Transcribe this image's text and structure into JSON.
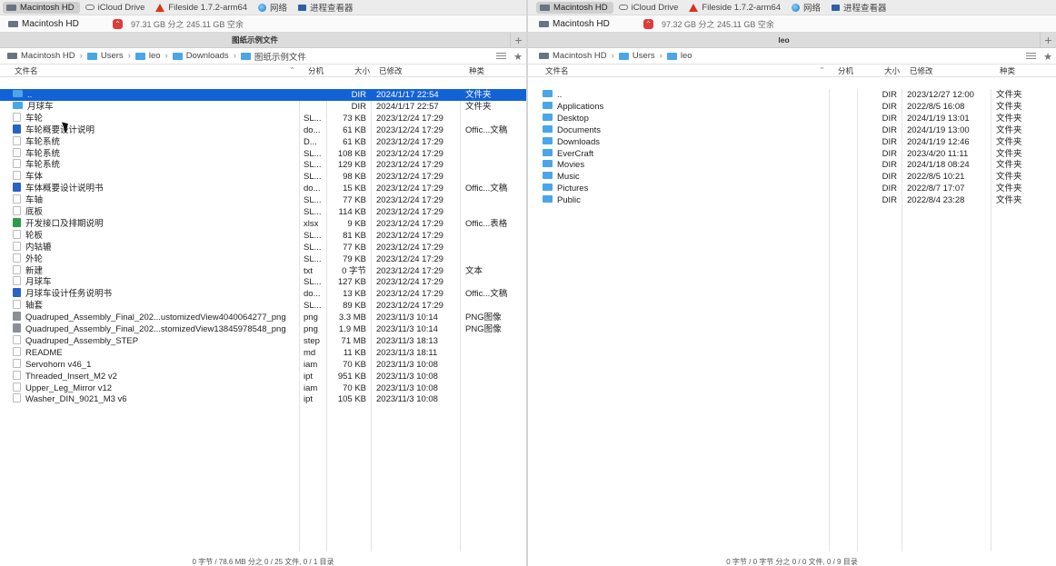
{
  "favorites": [
    {
      "label": "Macintosh HD",
      "icon": "hdd-icon",
      "active": true
    },
    {
      "label": "iCloud Drive",
      "icon": "cloud-icon"
    },
    {
      "label": "Fileside 1.7.2-arm64",
      "icon": "fileside-icon"
    },
    {
      "label": "网络",
      "icon": "globe-icon"
    },
    {
      "label": "进程查看器",
      "icon": "monitor-icon"
    }
  ],
  "headers": {
    "name": "文件名",
    "ext": "分机",
    "size": "大小",
    "modified": "已修改",
    "kind": "种类"
  },
  "left": {
    "volume": {
      "name": "Macintosh HD",
      "space": "97.31 GB 分之 245.11 GB 空余"
    },
    "title": "图纸示例文件",
    "breadcrumb": [
      "Macintosh HD",
      "Users",
      "leo",
      "Downloads",
      "图纸示例文件"
    ],
    "status": "0 字节 / 78.6 MB 分之 0 / 25 文件, 0 / 1 目录",
    "files": [
      {
        "name": "..",
        "ext": "",
        "size": "DIR",
        "modified": "2024/1/17 22:54",
        "kind": "文件夹",
        "icon": "folder"
      },
      {
        "name": "月球车",
        "ext": "",
        "size": "DIR",
        "modified": "2024/1/17 22:57",
        "kind": "文件夹",
        "icon": "folder"
      },
      {
        "name": "车轮",
        "ext": "SL...",
        "size": "73 KB",
        "modified": "2023/12/24 17:29",
        "kind": "",
        "icon": "doc"
      },
      {
        "name": "车轮概要设计说明",
        "ext": "do...",
        "size": "61 KB",
        "modified": "2023/12/24 17:29",
        "kind": "Offic...文稿",
        "icon": "word"
      },
      {
        "name": "车轮系统",
        "ext": "D...",
        "size": "61 KB",
        "modified": "2023/12/24 17:29",
        "kind": "",
        "icon": "doc"
      },
      {
        "name": "车轮系统",
        "ext": "SL...",
        "size": "108 KB",
        "modified": "2023/12/24 17:29",
        "kind": "",
        "icon": "doc"
      },
      {
        "name": "车轮系统",
        "ext": "SL...",
        "size": "129 KB",
        "modified": "2023/12/24 17:29",
        "kind": "",
        "icon": "doc"
      },
      {
        "name": "车体",
        "ext": "SL...",
        "size": "98 KB",
        "modified": "2023/12/24 17:29",
        "kind": "",
        "icon": "doc"
      },
      {
        "name": "车体概要设计说明书",
        "ext": "do...",
        "size": "15 KB",
        "modified": "2023/12/24 17:29",
        "kind": "Offic...文稿",
        "icon": "word"
      },
      {
        "name": "车轴",
        "ext": "SL...",
        "size": "77 KB",
        "modified": "2023/12/24 17:29",
        "kind": "",
        "icon": "doc"
      },
      {
        "name": "底板",
        "ext": "SL...",
        "size": "114 KB",
        "modified": "2023/12/24 17:29",
        "kind": "",
        "icon": "doc"
      },
      {
        "name": "开发接口及排期说明",
        "ext": "xlsx",
        "size": "9 KB",
        "modified": "2023/12/24 17:29",
        "kind": "Offic...表格",
        "icon": "xls"
      },
      {
        "name": "轮板",
        "ext": "SL...",
        "size": "81 KB",
        "modified": "2023/12/24 17:29",
        "kind": "",
        "icon": "doc"
      },
      {
        "name": "内轱辘",
        "ext": "SL...",
        "size": "77 KB",
        "modified": "2023/12/24 17:29",
        "kind": "",
        "icon": "doc"
      },
      {
        "name": "外轮",
        "ext": "SL...",
        "size": "79 KB",
        "modified": "2023/12/24 17:29",
        "kind": "",
        "icon": "doc"
      },
      {
        "name": "新建",
        "ext": "txt",
        "size": "0 字节",
        "modified": "2023/12/24 17:29",
        "kind": "文本",
        "icon": "doc"
      },
      {
        "name": "月球车",
        "ext": "SL...",
        "size": "127 KB",
        "modified": "2023/12/24 17:29",
        "kind": "",
        "icon": "doc"
      },
      {
        "name": "月球车设计任务说明书",
        "ext": "do...",
        "size": "13 KB",
        "modified": "2023/12/24 17:29",
        "kind": "Offic...文稿",
        "icon": "word"
      },
      {
        "name": "轴套",
        "ext": "SL...",
        "size": "89 KB",
        "modified": "2023/12/24 17:29",
        "kind": "",
        "icon": "doc"
      },
      {
        "name": "Quadruped_Assembly_Final_202...ustomizedView4040064277_png",
        "ext": "png",
        "size": "3.3 MB",
        "modified": "2023/11/3 10:14",
        "kind": "PNG图像",
        "icon": "img"
      },
      {
        "name": "Quadruped_Assembly_Final_202...stomizedView13845978548_png",
        "ext": "png",
        "size": "1.9 MB",
        "modified": "2023/11/3 10:14",
        "kind": "PNG图像",
        "icon": "img"
      },
      {
        "name": "Quadruped_Assembly_STEP",
        "ext": "step",
        "size": "71 MB",
        "modified": "2023/11/3 18:13",
        "kind": "",
        "icon": "doc"
      },
      {
        "name": "README",
        "ext": "md",
        "size": "11 KB",
        "modified": "2023/11/3 18:11",
        "kind": "",
        "icon": "doc"
      },
      {
        "name": "Servohorn v46_1",
        "ext": "iam",
        "size": "70 KB",
        "modified": "2023/11/3 10:08",
        "kind": "",
        "icon": "doc"
      },
      {
        "name": "Threaded_Insert_M2 v2",
        "ext": "ipt",
        "size": "951 KB",
        "modified": "2023/11/3 10:08",
        "kind": "",
        "icon": "doc"
      },
      {
        "name": "Upper_Leg_Mirror v12",
        "ext": "iam",
        "size": "70 KB",
        "modified": "2023/11/3 10:08",
        "kind": "",
        "icon": "doc"
      },
      {
        "name": "Washer_DIN_9021_M3 v6",
        "ext": "ipt",
        "size": "105 KB",
        "modified": "2023/11/3 10:08",
        "kind": "",
        "icon": "doc"
      }
    ]
  },
  "right": {
    "volume": {
      "name": "Macintosh HD",
      "space": "97.32 GB 分之 245.11 GB 空余"
    },
    "title": "leo",
    "breadcrumb": [
      "Macintosh HD",
      "Users",
      "leo"
    ],
    "status": "0 字节 / 0 字节 分之 0 / 0 文件, 0 / 9 目录",
    "files": [
      {
        "name": "..",
        "ext": "",
        "size": "DIR",
        "modified": "2023/12/27 12:00",
        "kind": "文件夹",
        "icon": "folder"
      },
      {
        "name": "Applications",
        "ext": "",
        "size": "DIR",
        "modified": "2022/8/5 16:08",
        "kind": "文件夹",
        "icon": "folder"
      },
      {
        "name": "Desktop",
        "ext": "",
        "size": "DIR",
        "modified": "2024/1/19 13:01",
        "kind": "文件夹",
        "icon": "folder"
      },
      {
        "name": "Documents",
        "ext": "",
        "size": "DIR",
        "modified": "2024/1/19 13:00",
        "kind": "文件夹",
        "icon": "folder"
      },
      {
        "name": "Downloads",
        "ext": "",
        "size": "DIR",
        "modified": "2024/1/19 12:46",
        "kind": "文件夹",
        "icon": "folder"
      },
      {
        "name": "EverCraft",
        "ext": "",
        "size": "DIR",
        "modified": "2023/4/20 11:11",
        "kind": "文件夹",
        "icon": "folder"
      },
      {
        "name": "Movies",
        "ext": "",
        "size": "DIR",
        "modified": "2024/1/18 08:24",
        "kind": "文件夹",
        "icon": "folder"
      },
      {
        "name": "Music",
        "ext": "",
        "size": "DIR",
        "modified": "2022/8/5 10:21",
        "kind": "文件夹",
        "icon": "folder"
      },
      {
        "name": "Pictures",
        "ext": "",
        "size": "DIR",
        "modified": "2022/8/7 17:07",
        "kind": "文件夹",
        "icon": "folder"
      },
      {
        "name": "Public",
        "ext": "",
        "size": "DIR",
        "modified": "2022/8/4 23:28",
        "kind": "文件夹",
        "icon": "folder"
      }
    ]
  }
}
